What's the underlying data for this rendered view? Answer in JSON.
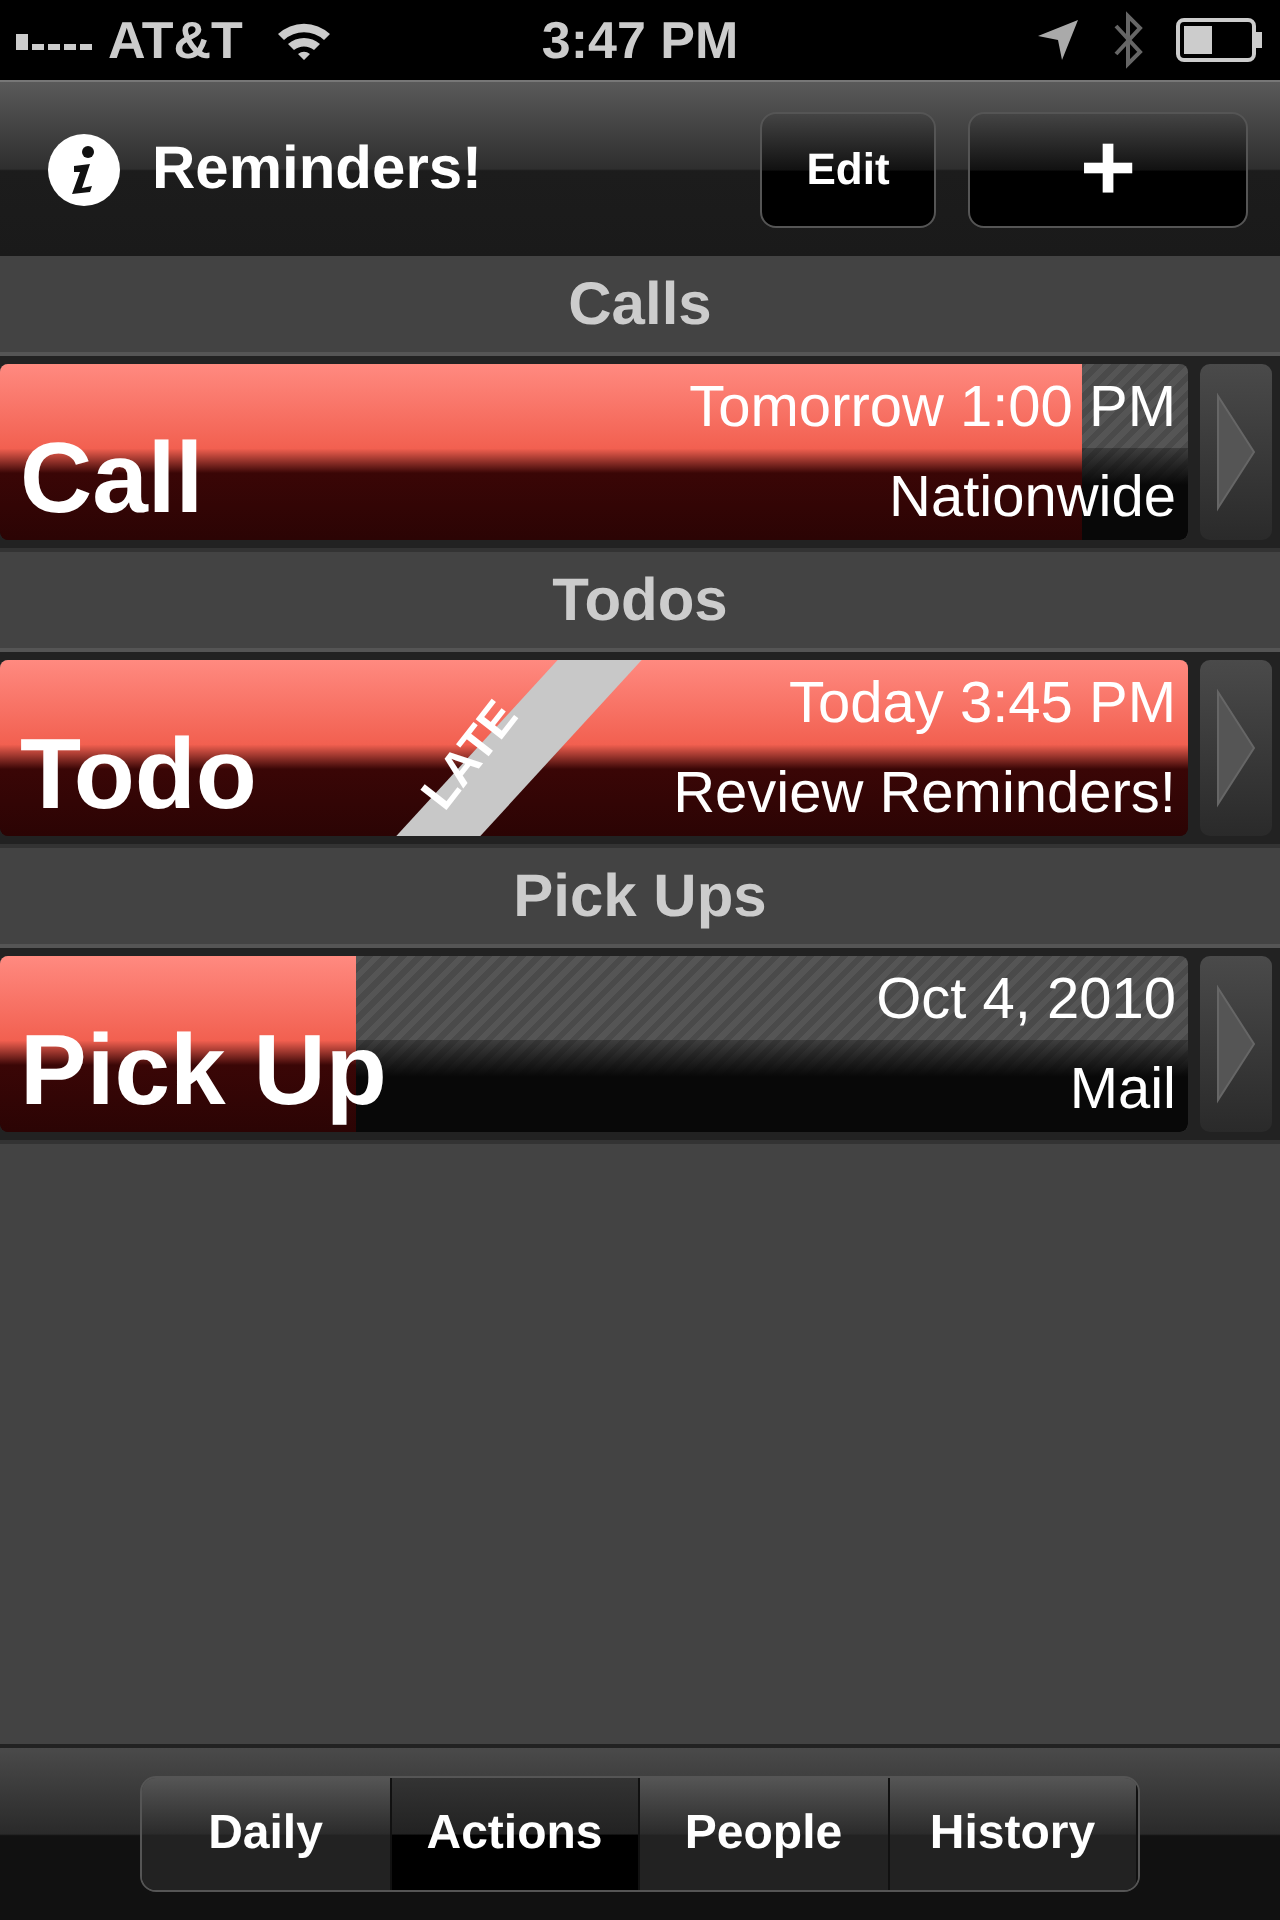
{
  "status_bar": {
    "carrier": "AT&T",
    "time": "3:47 PM"
  },
  "nav_bar": {
    "title": "Reminders!",
    "edit_button": "Edit",
    "add_button": "+"
  },
  "sections": [
    {
      "title": "Calls",
      "items": [
        {
          "title": "Call",
          "when": "Tomorrow 1:00 PM",
          "detail": "Nationwide",
          "level": 0.91,
          "late": false
        }
      ]
    },
    {
      "title": "Todos",
      "items": [
        {
          "title": "Todo",
          "when": "Today 3:45 PM",
          "detail": "Review Reminders!",
          "level": 1,
          "late": true,
          "late_label": "LATE"
        }
      ]
    },
    {
      "title": "Pick Ups",
      "items": [
        {
          "title": "Pick Up",
          "when": "Oct 4, 2010",
          "detail": "Mail",
          "level": 0.3,
          "late": false
        }
      ]
    }
  ],
  "tabs": [
    {
      "label": "Daily",
      "selected": false
    },
    {
      "label": "Actions",
      "selected": true
    },
    {
      "label": "People",
      "selected": false
    },
    {
      "label": "History",
      "selected": false
    }
  ]
}
